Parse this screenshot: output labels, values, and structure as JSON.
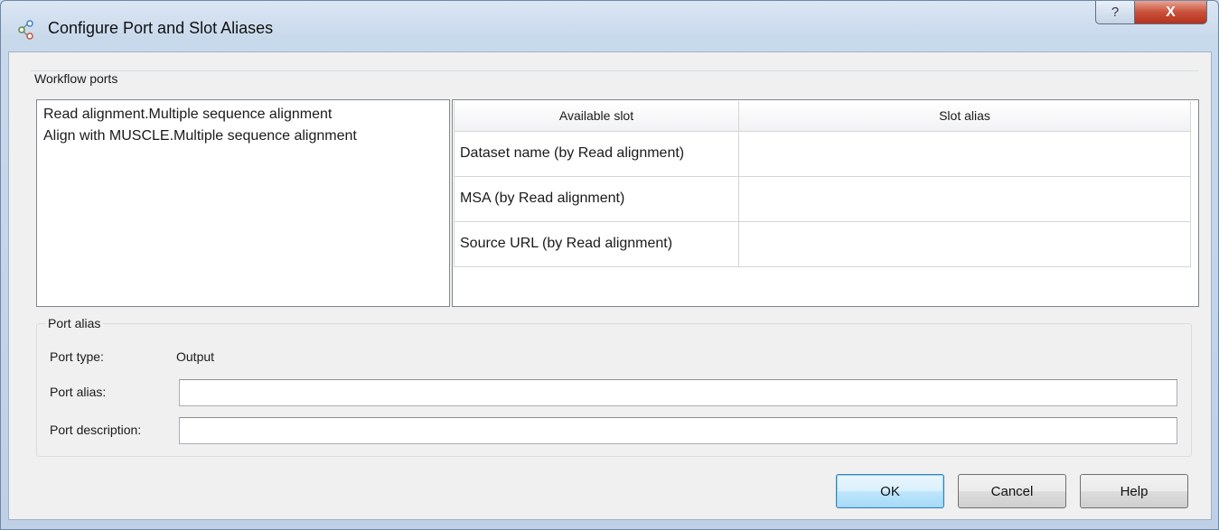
{
  "window": {
    "title": "Configure Port and Slot Aliases",
    "help_glyph": "?",
    "close_glyph": "X"
  },
  "workflow_ports": {
    "group_label": "Workflow ports",
    "items": [
      "Read alignment.Multiple sequence alignment",
      "Align with MUSCLE.Multiple sequence alignment"
    ]
  },
  "slots": {
    "columns": [
      "Available slot",
      "Slot alias"
    ],
    "rows": [
      {
        "slot": "Dataset name (by Read alignment)",
        "alias": ""
      },
      {
        "slot": "MSA (by Read alignment)",
        "alias": ""
      },
      {
        "slot": "Source URL (by Read alignment)",
        "alias": ""
      }
    ]
  },
  "port_alias": {
    "group_label": "Port alias",
    "type_label": "Port type:",
    "type_value": "Output",
    "alias_label": "Port alias:",
    "alias_value": "",
    "description_label": "Port description:",
    "description_value": ""
  },
  "buttons": {
    "ok": "OK",
    "cancel": "Cancel",
    "help": "Help"
  },
  "colors": {
    "title_bar": "#c9d9ec",
    "close_button": "#c9503a",
    "default_button": "#bee6fd"
  }
}
